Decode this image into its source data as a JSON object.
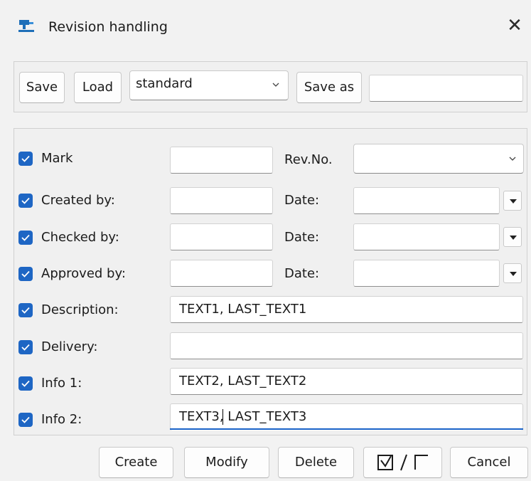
{
  "window": {
    "title": "Revision handling",
    "icon": "app-icon",
    "close_glyph": "✕"
  },
  "toolbar": {
    "save_label": "Save",
    "load_label": "Load",
    "preset_value": "standard",
    "save_as_label": "Save as",
    "save_as_value": ""
  },
  "fields": {
    "mark": {
      "label": "Mark",
      "checked": true,
      "value": ""
    },
    "rev_no": {
      "label": "Rev.No.",
      "value": ""
    },
    "created_by": {
      "label": "Created by:",
      "checked": true,
      "value": "",
      "date_label": "Date:",
      "date_value": ""
    },
    "checked_by": {
      "label": "Checked by:",
      "checked": true,
      "value": "",
      "date_label": "Date:",
      "date_value": ""
    },
    "approved_by": {
      "label": "Approved by:",
      "checked": true,
      "value": "",
      "date_label": "Date:",
      "date_value": ""
    },
    "description": {
      "label": "Description:",
      "checked": true,
      "value": "TEXT1, LAST_TEXT1"
    },
    "delivery": {
      "label": "Delivery:",
      "checked": true,
      "value": ""
    },
    "info1": {
      "label": "Info 1:",
      "checked": true,
      "value": "TEXT2, LAST_TEXT2"
    },
    "info2": {
      "label": "Info 2:",
      "checked": true,
      "value": "TEXT3, LAST_TEXT3"
    }
  },
  "buttons": {
    "create": "Create",
    "modify": "Modify",
    "delete": "Delete",
    "cancel": "Cancel"
  },
  "colors": {
    "accent": "#1e66c4",
    "background": "#f2f2f2"
  }
}
